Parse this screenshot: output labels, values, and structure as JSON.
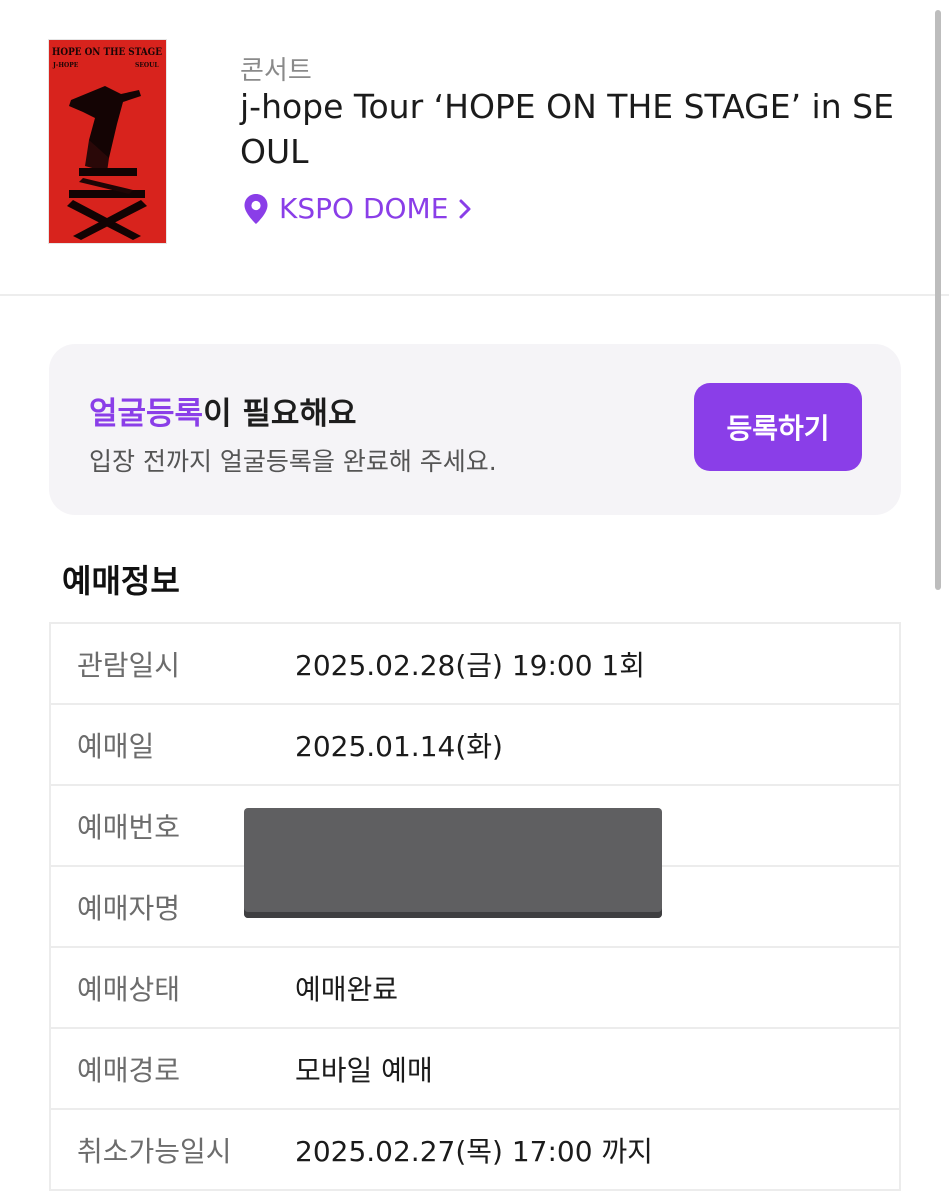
{
  "event": {
    "category": "콘서트",
    "title": "j-hope Tour ‘HOPE ON THE STAGE’ in SEOUL",
    "venue": "KSPO DOME",
    "poster": {
      "line1": "HOPE ON THE STAGE",
      "line2_left": "J-HOPE",
      "line2_right": "SEOUL"
    }
  },
  "banner": {
    "heading_accent": "얼굴등록",
    "heading_rest": "이 필요해요",
    "subtext": "입장 전까지 얼굴등록을 완료해 주세요.",
    "button_label": "등록하기"
  },
  "booking": {
    "section_title": "예매정보",
    "rows": [
      {
        "label": "관람일시",
        "value": "2025.02.28(금) 19:00 1회"
      },
      {
        "label": "예매일",
        "value": "2025.01.14(화)"
      },
      {
        "label": "예매번호",
        "value": ""
      },
      {
        "label": "예매자명",
        "value": ""
      },
      {
        "label": "예매상태",
        "value": "예매완료"
      },
      {
        "label": "예매경로",
        "value": "모바일 예매"
      },
      {
        "label": "취소가능일시",
        "value": "2025.02.27(목) 17:00 까지"
      }
    ]
  },
  "colors": {
    "accent": "#8a3ee8",
    "poster_red": "#d8231d",
    "banner_bg": "#f5f4f7"
  },
  "icons": {
    "venue": "map-pin-icon",
    "venue_link": "chevron-right-icon"
  }
}
